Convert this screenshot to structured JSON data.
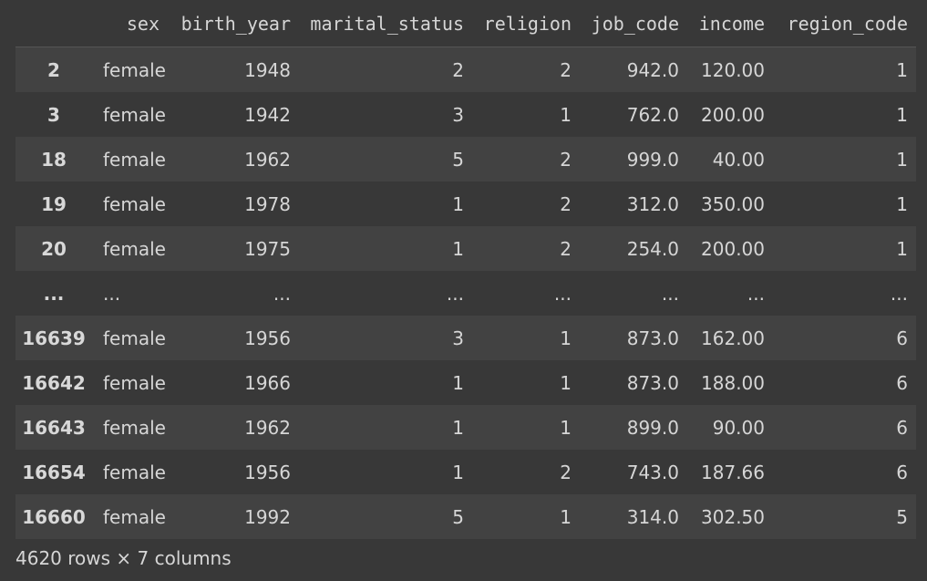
{
  "table": {
    "columns": [
      "",
      "sex",
      "birth_year",
      "marital_status",
      "religion",
      "job_code",
      "income",
      "region_code"
    ],
    "rows": [
      [
        "2",
        "female",
        "1948",
        "2",
        "2",
        "942.0",
        "120.00",
        "1"
      ],
      [
        "3",
        "female",
        "1942",
        "3",
        "1",
        "762.0",
        "200.00",
        "1"
      ],
      [
        "18",
        "female",
        "1962",
        "5",
        "2",
        "999.0",
        "40.00",
        "1"
      ],
      [
        "19",
        "female",
        "1978",
        "1",
        "2",
        "312.0",
        "350.00",
        "1"
      ],
      [
        "20",
        "female",
        "1975",
        "1",
        "2",
        "254.0",
        "200.00",
        "1"
      ],
      [
        "...",
        "...",
        "...",
        "...",
        "...",
        "...",
        "...",
        "..."
      ],
      [
        "16639",
        "female",
        "1956",
        "3",
        "1",
        "873.0",
        "162.00",
        "6"
      ],
      [
        "16642",
        "female",
        "1966",
        "1",
        "1",
        "873.0",
        "188.00",
        "6"
      ],
      [
        "16643",
        "female",
        "1962",
        "1",
        "1",
        "899.0",
        "90.00",
        "6"
      ],
      [
        "16654",
        "female",
        "1956",
        "1",
        "2",
        "743.0",
        "187.66",
        "6"
      ],
      [
        "16660",
        "female",
        "1992",
        "5",
        "1",
        "314.0",
        "302.50",
        "5"
      ]
    ]
  },
  "footer": {
    "summary": "4620 rows × 7 columns"
  }
}
